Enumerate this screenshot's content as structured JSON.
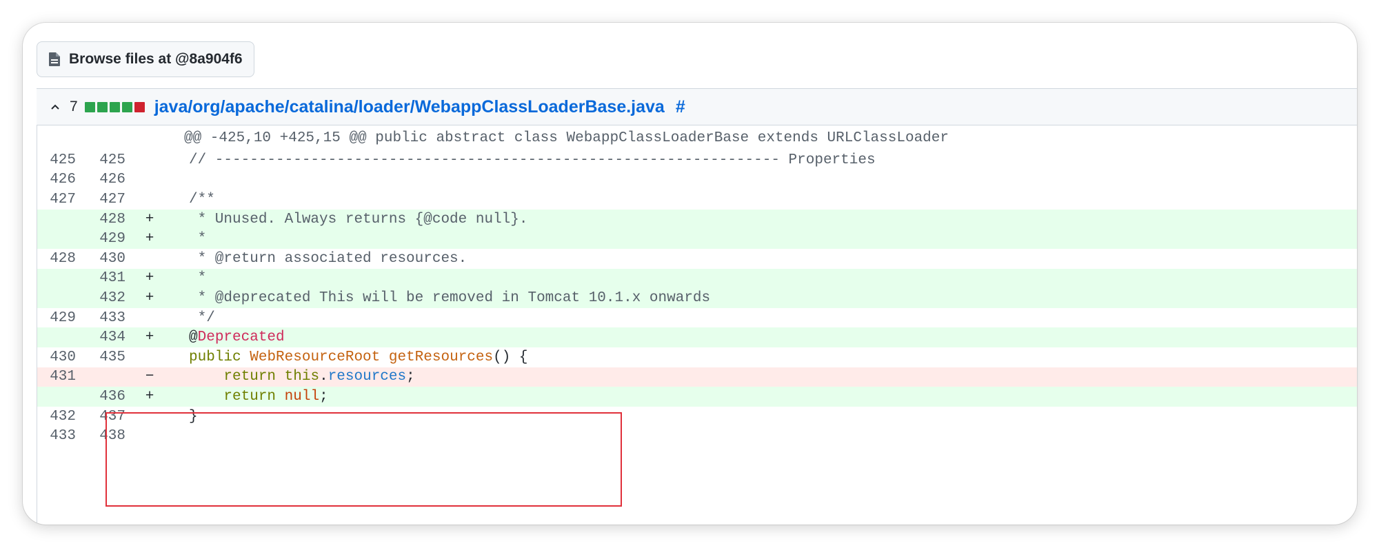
{
  "browse_button": {
    "label": "Browse files at @8a904f6",
    "icon": "file-icon"
  },
  "file_header": {
    "chevron_icon": "chevron-up-icon",
    "changes": "7",
    "diffstat": [
      "#2da44e",
      "#2da44e",
      "#2da44e",
      "#2da44e",
      "#cf222e"
    ],
    "path": "java/org/apache/catalina/loader/WebappClassLoaderBase.java",
    "anchor": "#"
  },
  "diff": {
    "hunk_header": "@@ -425,10 +425,15 @@ public abstract class WebappClassLoaderBase extends URLClassLoader",
    "lines": [
      {
        "type": "ctx",
        "old": "425",
        "new": "425",
        "marker": "",
        "code": "// ----------------------------------------------------------------- Properties"
      },
      {
        "type": "ctx",
        "old": "426",
        "new": "426",
        "marker": "",
        "code": ""
      },
      {
        "type": "ctx",
        "old": "427",
        "new": "427",
        "marker": "",
        "code": "/**"
      },
      {
        "type": "add",
        "old": "",
        "new": "428",
        "marker": "+",
        "code": " * Unused. Always returns {@code null}."
      },
      {
        "type": "add",
        "old": "",
        "new": "429",
        "marker": "+",
        "code": " *"
      },
      {
        "type": "ctx",
        "old": "428",
        "new": "430",
        "marker": "",
        "code": " * @return associated resources."
      },
      {
        "type": "add",
        "old": "",
        "new": "431",
        "marker": "+",
        "code": " *"
      },
      {
        "type": "add",
        "old": "",
        "new": "432",
        "marker": "+",
        "code": " * @deprecated This will be removed in Tomcat 10.1.x onwards"
      },
      {
        "type": "ctx",
        "old": "429",
        "new": "433",
        "marker": "",
        "code": " */"
      },
      {
        "type": "add",
        "old": "",
        "new": "434",
        "marker": "+",
        "code": "@Deprecated"
      },
      {
        "type": "ctx",
        "old": "430",
        "new": "435",
        "marker": "",
        "code": "public WebResourceRoot getResources() {"
      },
      {
        "type": "del",
        "old": "431",
        "new": "",
        "marker": "−",
        "code": "    return this.resources;"
      },
      {
        "type": "add",
        "old": "",
        "new": "436",
        "marker": "+",
        "code": "    return null;"
      },
      {
        "type": "ctx",
        "old": "432",
        "new": "437",
        "marker": "",
        "code": "}"
      },
      {
        "type": "ctx",
        "old": "433",
        "new": "438",
        "marker": "",
        "code": ""
      }
    ]
  },
  "colors": {
    "add_bg": "#e6ffec",
    "del_bg": "#ffebe9",
    "link": "#0969da",
    "highlight_border": "#e0303a"
  }
}
